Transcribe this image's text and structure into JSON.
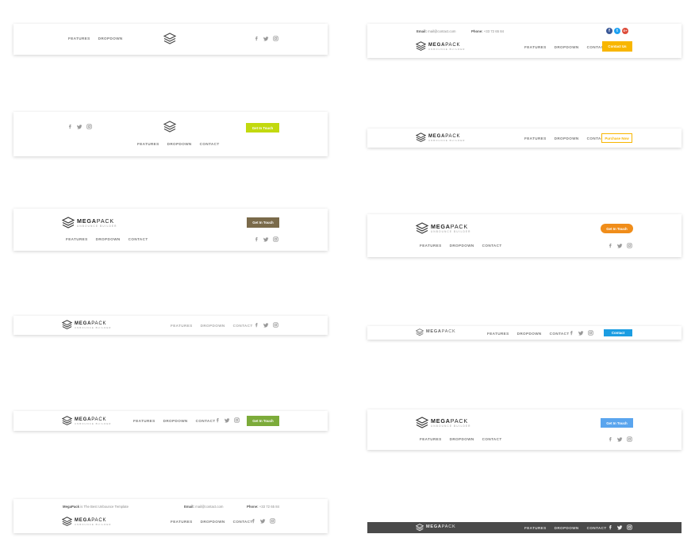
{
  "brand": {
    "name_bold": "MEGA",
    "name_light": "PACK",
    "tagline": "UNBOUNCE BUILDER"
  },
  "nav": {
    "features": "FEATURES",
    "dropdown": "DROPDOWN",
    "contact": "CONTACT"
  },
  "topbar": {
    "email_label": "Email:",
    "email_value": "mail@contact.com",
    "phone_label": "Phone:",
    "phone_value": "+33 72 65 84",
    "tagline_bold": "MegaPack",
    "tagline_rest": " is The Best Unbounce Template"
  },
  "social_round": {
    "facebook": "f",
    "twitter": "t",
    "google": "G+"
  },
  "buttons": {
    "get_in_touch": "Get In Touch",
    "contact_us": "Contact Us",
    "purchase_now": "Purchase Now",
    "contact": "Contact"
  },
  "colors": {
    "lime": "#c2d90f",
    "olive": "#7a6a4a",
    "green": "#7cab3a",
    "amber": "#f8b600",
    "orange": "#f08d1a",
    "blue": "#1b9de2",
    "lightblue": "#5aa5ee",
    "dark": "#4a4a4a",
    "facebook": "#3b5998",
    "twitter": "#1da1f2",
    "google": "#dd4b39"
  },
  "icons": [
    "facebook-icon",
    "twitter-icon",
    "instagram-icon",
    "megapack-logo-icon"
  ]
}
